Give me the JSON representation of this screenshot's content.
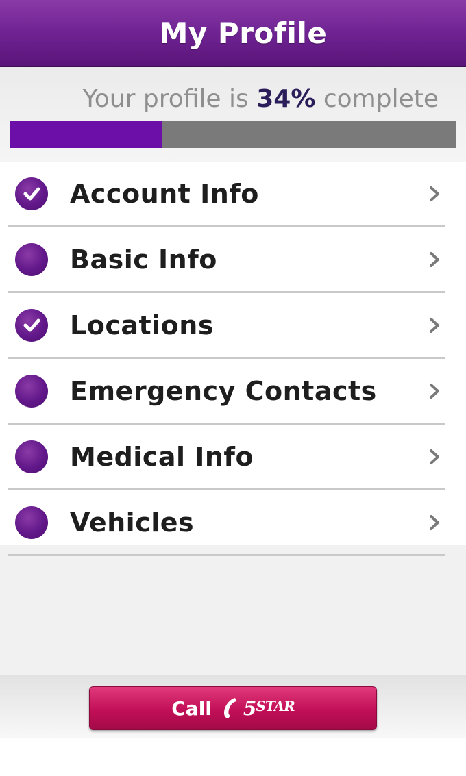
{
  "header": {
    "title": "My Profile"
  },
  "progress": {
    "text_prefix": "Your profile is ",
    "percent_label": "34%",
    "text_suffix": " complete",
    "value_percent": 34
  },
  "sections": [
    {
      "label": "Account Info",
      "completed": true
    },
    {
      "label": "Basic Info",
      "completed": false
    },
    {
      "label": "Locations",
      "completed": true
    },
    {
      "label": "Emergency Contacts",
      "completed": false
    },
    {
      "label": "Medical Info",
      "completed": false
    },
    {
      "label": "Vehicles",
      "completed": false
    }
  ],
  "footer": {
    "call_label": "Call",
    "brand_big": "5",
    "brand_small": "STAR"
  },
  "colors": {
    "header_purple": "#6f2393",
    "progress_fill": "#6b0fa8",
    "progress_track": "#7a7a7a",
    "status_dot": "#62188a",
    "call_button": "#c20f57"
  },
  "icons": {
    "check": "check-icon",
    "chevron": "chevron-right-icon",
    "phone": "phone-icon"
  }
}
